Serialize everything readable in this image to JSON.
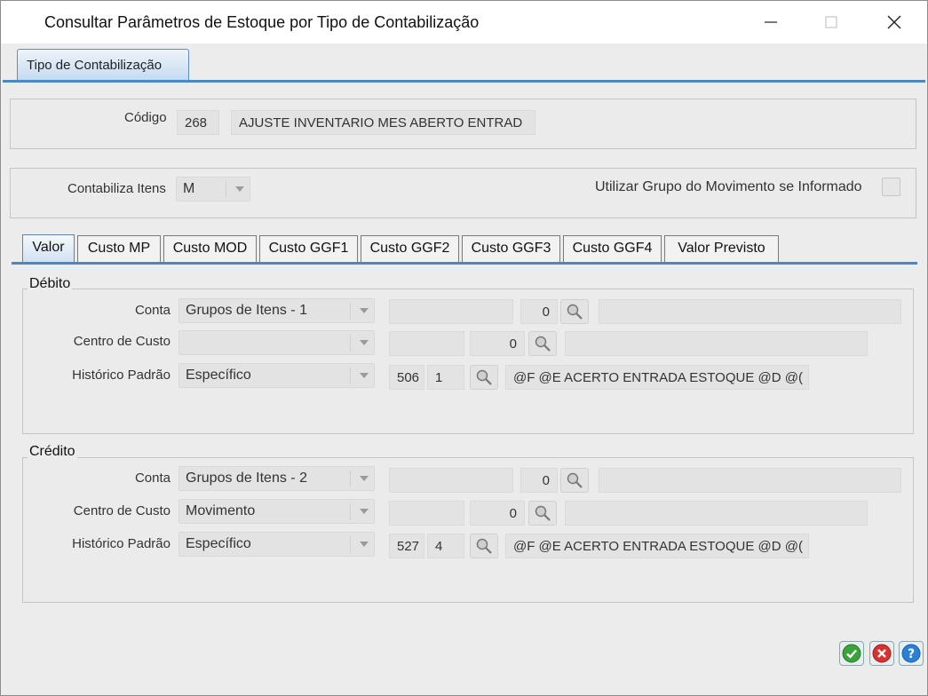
{
  "window": {
    "title": "Consultar Parâmetros de Estoque por Tipo de Contabilização"
  },
  "outer_tab": {
    "label": "Tipo de Contabilização"
  },
  "header": {
    "codigo_label": "Código",
    "codigo_value": "268",
    "descricao_value": "AJUSTE INVENTARIO MES ABERTO ENTRAD"
  },
  "options": {
    "contabiliza_label": "Contabiliza Itens",
    "contabiliza_value": "M",
    "utilizar_label": "Utilizar Grupo do Movimento se Informado"
  },
  "tabs": [
    {
      "label": "Valor"
    },
    {
      "label": "Custo MP"
    },
    {
      "label": "Custo MOD"
    },
    {
      "label": "Custo GGF1"
    },
    {
      "label": "Custo GGF2"
    },
    {
      "label": "Custo GGF3"
    },
    {
      "label": "Custo GGF4"
    },
    {
      "label": "Valor Previsto"
    }
  ],
  "debito": {
    "title": "Débito",
    "conta_label": "Conta",
    "conta_value": "Grupos de Itens - 1",
    "conta_code": "0",
    "centro_label": "Centro de Custo",
    "centro_value": "",
    "centro_code": "0",
    "historico_label": "Histórico Padrão",
    "historico_value": "Específico",
    "historico_code": "506",
    "historico_seq": "1",
    "historico_text": "@F @E ACERTO ENTRADA ESTOQUE @D @("
  },
  "credito": {
    "title": "Crédito",
    "conta_label": "Conta",
    "conta_value": "Grupos de Itens - 2",
    "conta_code": "0",
    "centro_label": "Centro de Custo",
    "centro_value": "Movimento",
    "centro_code": "0",
    "historico_label": "Histórico Padrão",
    "historico_value": "Específico",
    "historico_code": "527",
    "historico_seq": "4",
    "historico_text": "@F @E ACERTO ENTRADA ESTOQUE @D @("
  },
  "actions": {
    "ok_color": "#3aa33a",
    "cancel_color": "#d93030",
    "help_color": "#2a7fd6"
  }
}
